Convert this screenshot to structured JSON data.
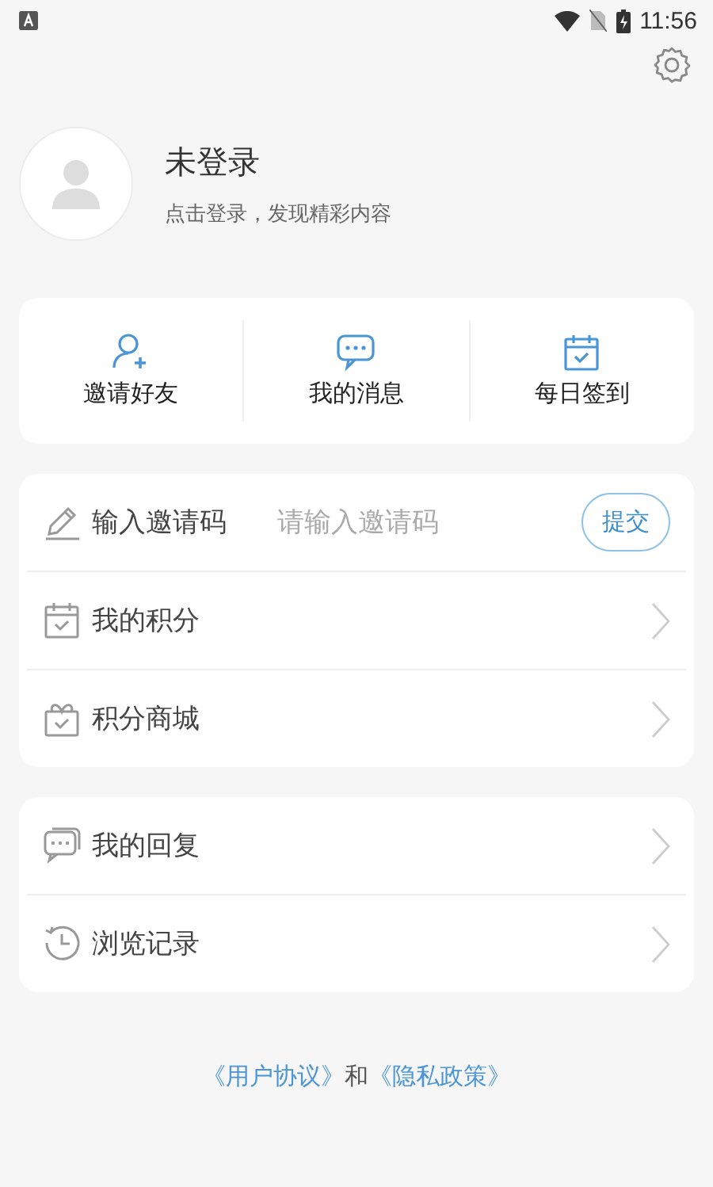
{
  "status_bar": {
    "time": "11:56"
  },
  "profile": {
    "name": "未登录",
    "subtitle": "点击登录，发现精彩内容"
  },
  "quick_actions": [
    {
      "label": "邀请好友",
      "kind": "invite"
    },
    {
      "label": "我的消息",
      "kind": "message"
    },
    {
      "label": "每日签到",
      "kind": "checkin"
    }
  ],
  "invite_code": {
    "label": "输入邀请码",
    "placeholder": "请输入邀请码",
    "button": "提交"
  },
  "menu_groups": [
    [
      {
        "label": "我的积分",
        "kind": "points"
      },
      {
        "label": "积分商城",
        "kind": "shop"
      }
    ],
    [
      {
        "label": "我的回复",
        "kind": "reply"
      },
      {
        "label": "浏览记录",
        "kind": "history"
      }
    ]
  ],
  "footer": [
    {
      "text": "《用户协议》",
      "kind": "link"
    },
    {
      "text": "和",
      "kind": "text"
    },
    {
      "text": "《隐私政策》",
      "kind": "link"
    }
  ]
}
